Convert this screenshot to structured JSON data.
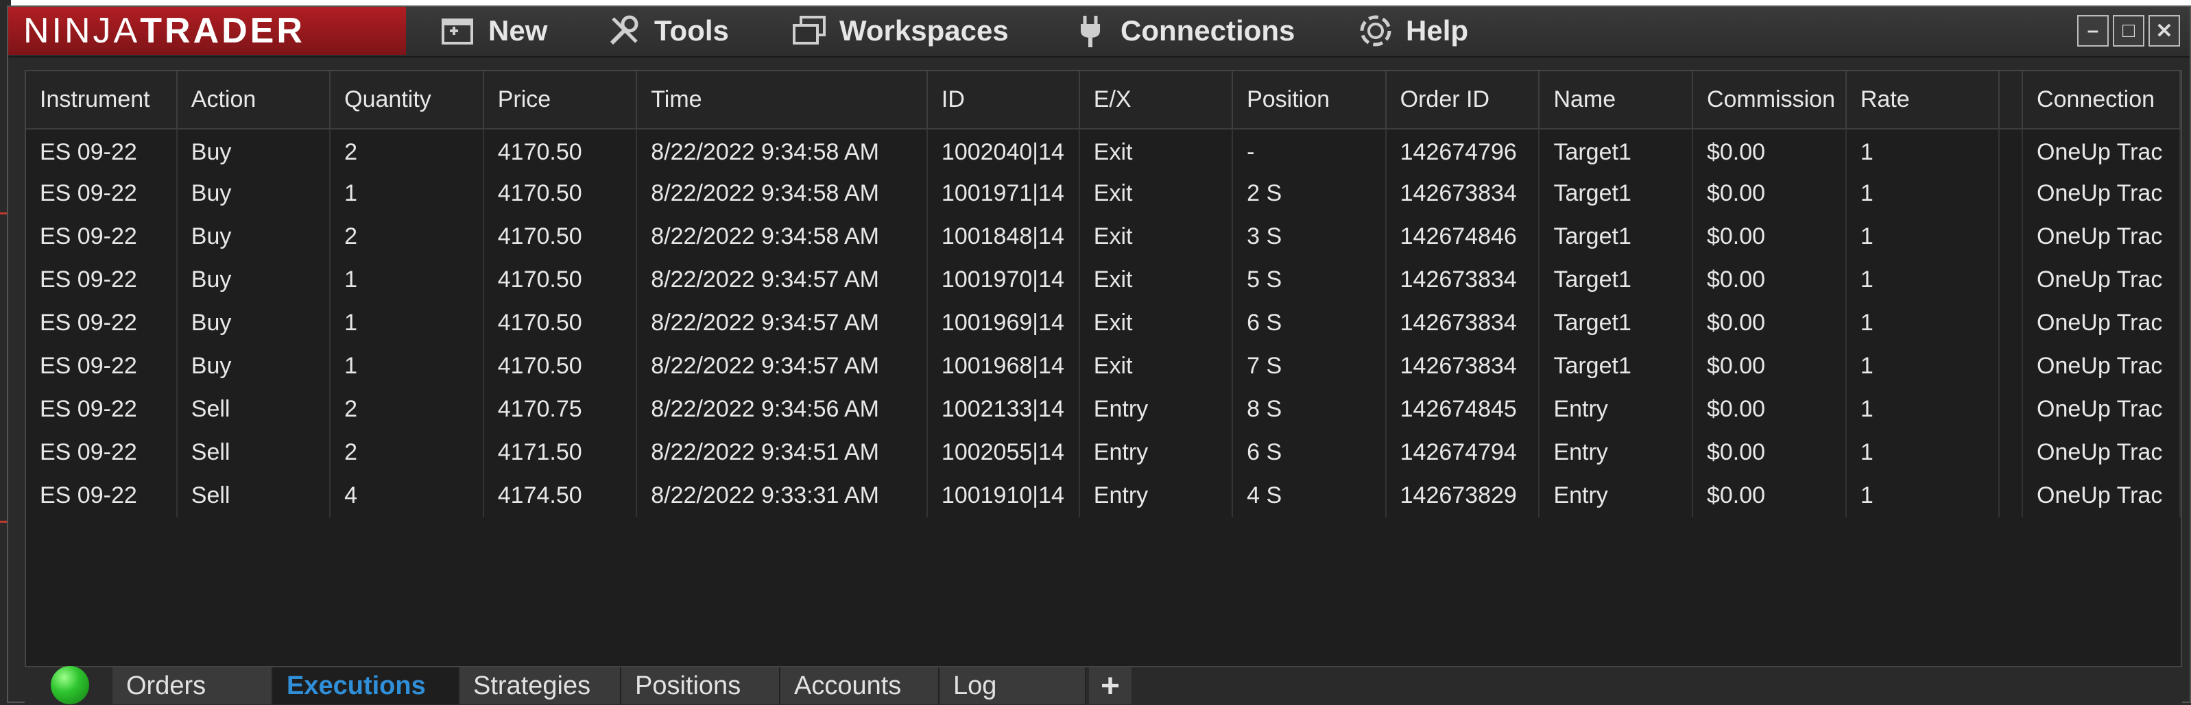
{
  "app": {
    "logo_part1": "NINJA",
    "logo_part2": "TRADER"
  },
  "menu": {
    "new": "New",
    "tools": "Tools",
    "workspaces": "Workspaces",
    "connections": "Connections",
    "help": "Help"
  },
  "window_buttons": {
    "minimize": "–",
    "maximize": "□",
    "close": "✕"
  },
  "table": {
    "columns": [
      "Instrument",
      "Action",
      "Quantity",
      "Price",
      "Time",
      "ID",
      "E/X",
      "Position",
      "Order ID",
      "Name",
      "Commission",
      "Rate",
      "",
      "Connection"
    ],
    "rows": [
      [
        "ES 09-22",
        "Buy",
        "2",
        "4170.50",
        "8/22/2022 9:34:58 AM",
        "1002040|14",
        "Exit",
        "-",
        "142674796",
        "Target1",
        "$0.00",
        "1",
        "",
        "OneUp Trac"
      ],
      [
        "ES 09-22",
        "Buy",
        "1",
        "4170.50",
        "8/22/2022 9:34:58 AM",
        "1001971|14",
        "Exit",
        "2 S",
        "142673834",
        "Target1",
        "$0.00",
        "1",
        "",
        "OneUp Trac"
      ],
      [
        "ES 09-22",
        "Buy",
        "2",
        "4170.50",
        "8/22/2022 9:34:58 AM",
        "1001848|14",
        "Exit",
        "3 S",
        "142674846",
        "Target1",
        "$0.00",
        "1",
        "",
        "OneUp Trac"
      ],
      [
        "ES 09-22",
        "Buy",
        "1",
        "4170.50",
        "8/22/2022 9:34:57 AM",
        "1001970|14",
        "Exit",
        "5 S",
        "142673834",
        "Target1",
        "$0.00",
        "1",
        "",
        "OneUp Trac"
      ],
      [
        "ES 09-22",
        "Buy",
        "1",
        "4170.50",
        "8/22/2022 9:34:57 AM",
        "1001969|14",
        "Exit",
        "6 S",
        "142673834",
        "Target1",
        "$0.00",
        "1",
        "",
        "OneUp Trac"
      ],
      [
        "ES 09-22",
        "Buy",
        "1",
        "4170.50",
        "8/22/2022 9:34:57 AM",
        "1001968|14",
        "Exit",
        "7 S",
        "142673834",
        "Target1",
        "$0.00",
        "1",
        "",
        "OneUp Trac"
      ],
      [
        "ES 09-22",
        "Sell",
        "2",
        "4170.75",
        "8/22/2022 9:34:56 AM",
        "1002133|14",
        "Entry",
        "8 S",
        "142674845",
        "Entry",
        "$0.00",
        "1",
        "",
        "OneUp Trac"
      ],
      [
        "ES 09-22",
        "Sell",
        "2",
        "4171.50",
        "8/22/2022 9:34:51 AM",
        "1002055|14",
        "Entry",
        "6 S",
        "142674794",
        "Entry",
        "$0.00",
        "1",
        "",
        "OneUp Trac"
      ],
      [
        "ES 09-22",
        "Sell",
        "4",
        "4174.50",
        "8/22/2022 9:33:31 AM",
        "1001910|14",
        "Entry",
        "4 S",
        "142673829",
        "Entry",
        "$0.00",
        "1",
        "",
        "OneUp Trac"
      ]
    ]
  },
  "tabs": [
    {
      "label": "Orders",
      "active": false
    },
    {
      "label": "Executions",
      "active": true
    },
    {
      "label": "Strategies",
      "active": false
    },
    {
      "label": "Positions",
      "active": false
    },
    {
      "label": "Accounts",
      "active": false
    },
    {
      "label": "Log",
      "active": false
    }
  ],
  "add_tab_label": "+",
  "colors": {
    "brand_red": "#b01e22",
    "active_tab_text": "#2f8fd8",
    "connection_status": "#2fc52f"
  },
  "icons": {
    "new": "new-window-icon",
    "tools": "wrench-screwdriver-icon",
    "workspaces": "stacked-windows-icon",
    "connections": "plug-icon",
    "help": "lifebuoy-icon",
    "status": "connection-status-icon"
  }
}
